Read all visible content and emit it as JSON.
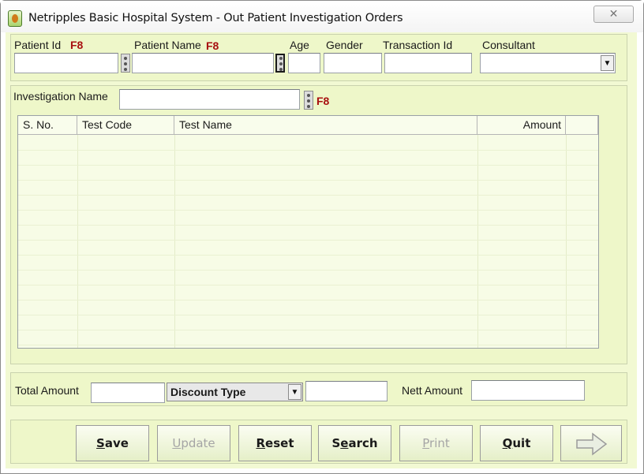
{
  "window": {
    "title": "Netripples Basic Hospital System - Out Patient Investigation Orders",
    "close_glyph": "✕"
  },
  "header": {
    "patient_id_label": "Patient Id",
    "patient_name_label": "Patient Name",
    "hotkey": "F8",
    "age_label": "Age",
    "gender_label": "Gender",
    "transaction_id_label": "Transaction Id",
    "consultant_label": "Consultant",
    "patient_id_value": "",
    "patient_name_value": "",
    "age_value": "",
    "gender_value": "",
    "transaction_id_value": "",
    "consultant_value": ""
  },
  "investigation": {
    "label": "Investigation Name",
    "value": "",
    "hotkey": "F8"
  },
  "grid": {
    "columns": [
      "S. No.",
      "Test Code",
      "Test Name",
      "Amount"
    ],
    "rows": []
  },
  "totals": {
    "total_amount_label": "Total Amount",
    "total_amount_value": "",
    "discount_type": "Discount Type",
    "discount_value": "",
    "nett_amount_label": "Nett Amount",
    "nett_amount_value": ""
  },
  "buttons": {
    "save": {
      "accel": "S",
      "rest": "ave"
    },
    "update": {
      "accel": "U",
      "rest": "pdate"
    },
    "reset": {
      "accel": "R",
      "rest": "eset"
    },
    "search": {
      "pre": "S",
      "accel": "e",
      "rest": "arch"
    },
    "print": {
      "accel": "P",
      "rest": "rint"
    },
    "quit": {
      "accel": "Q",
      "rest": "uit"
    }
  },
  "icons": {
    "next": "arrow-right-icon",
    "app": "hospital-app-icon",
    "close": "close-icon",
    "lookup": "lookup-dots-icon"
  },
  "colors": {
    "panel": "#eef7c9",
    "hotkey": "#a81010"
  }
}
